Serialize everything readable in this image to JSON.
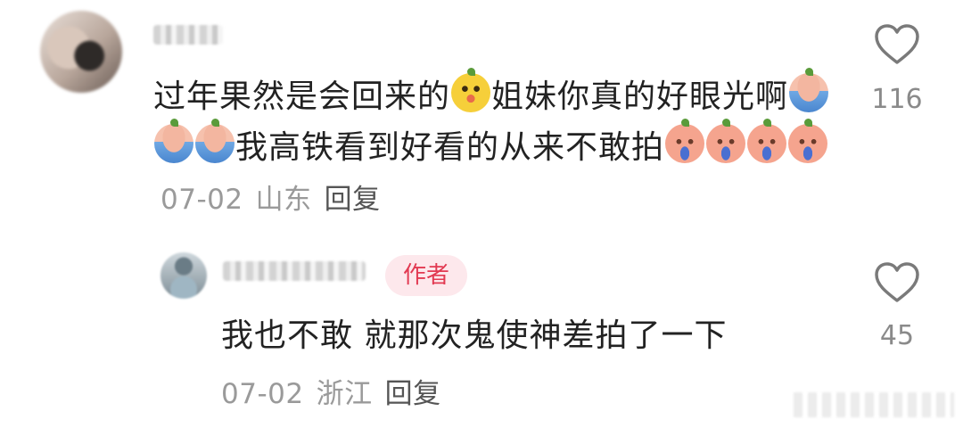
{
  "main_comment": {
    "text_part1": "过年果然是会回来的",
    "text_part2": "姐妹你真的好眼光啊",
    "text_part3": "我高铁看到好看的从来不敢拍",
    "emoji_yellow": "laughing-face-emoji",
    "emoji_blue": "crying-face-emoji",
    "emoji_peach": "sobbing-face-emoji",
    "date": "07-02",
    "location": "山东",
    "reply_label": "回复",
    "like_count": "116"
  },
  "reply_comment": {
    "author_badge": "作者",
    "text": "我也不敢 就那次鬼使神差拍了一下",
    "date": "07-02",
    "location": "浙江",
    "reply_label": "回复",
    "like_count": "45"
  }
}
